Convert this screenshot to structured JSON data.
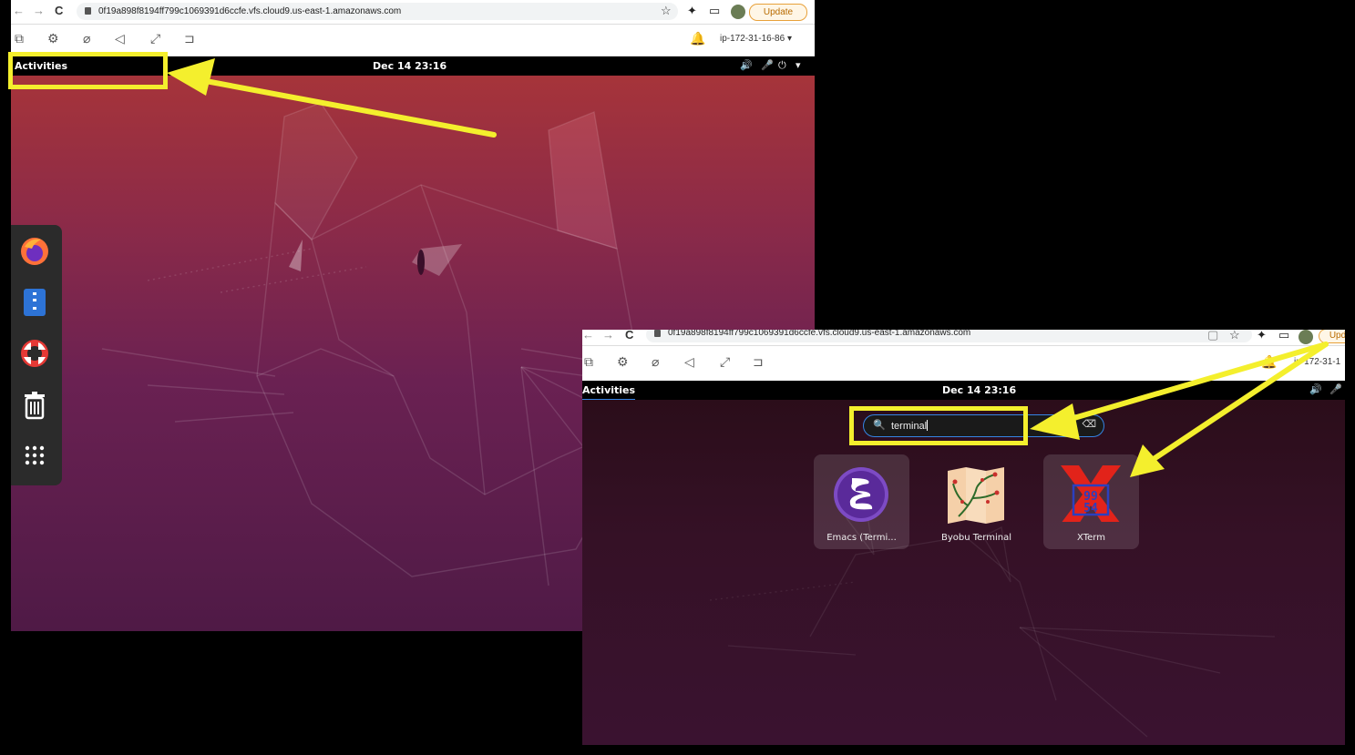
{
  "shot1": {
    "browser": {
      "url": "0f19a898f8194ff799c1069391d6ccfe.vfs.cloud9.us-east-1.amazonaws.com",
      "update_label": "Update"
    },
    "dcv": {
      "host": "ip-172-31-16-86"
    },
    "topbar": {
      "activities": "Activities",
      "clock": "Dec 14  23:16"
    },
    "dock": [
      "firefox-icon",
      "text-editor-icon",
      "help-icon",
      "trash-icon",
      "show-applications-icon"
    ]
  },
  "shot2": {
    "browser": {
      "url": "0f19a898f8194ff799c1069391d6ccfe.vfs.cloud9.us-east-1.amazonaws.com",
      "update_label": "Upd"
    },
    "dcv": {
      "host": "ip-172-31-1"
    },
    "topbar": {
      "activities": "Activities",
      "clock": "Dec 14  23:16"
    },
    "search": {
      "value": "terminal"
    },
    "apps": [
      {
        "label": "Emacs (Termi...",
        "icon": "emacs-icon"
      },
      {
        "label": "Byobu Terminal",
        "icon": "byobu-icon"
      },
      {
        "label": "XTerm",
        "icon": "xterm-icon"
      }
    ]
  },
  "colors": {
    "annotation": "#f4ef2d",
    "accent": "#3584e4",
    "update": "#e8a13a"
  }
}
